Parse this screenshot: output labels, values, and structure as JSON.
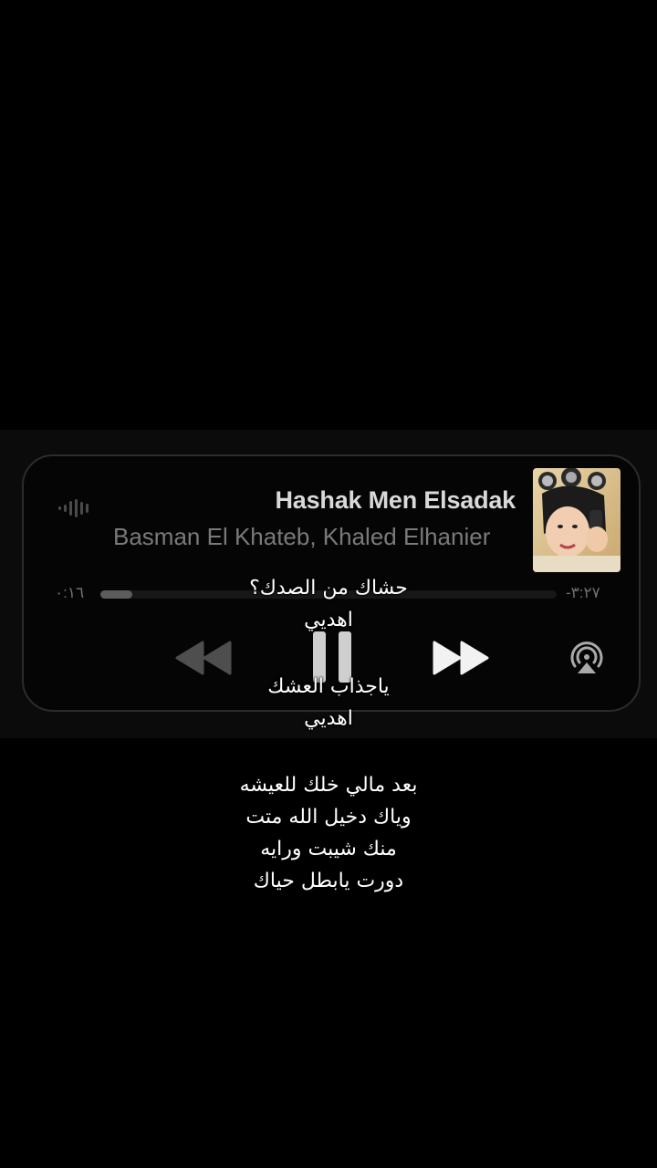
{
  "now_playing": {
    "title": "Hashak Men Elsadak",
    "artist": "Basman El Khateb, Khaled Elhanier",
    "elapsed": "٠:١٦",
    "remaining": "-٣:٢٧",
    "progress": 0.07
  },
  "controls": {
    "rewind_icon": "rewind-icon",
    "pause_icon": "pause-icon",
    "forward_icon": "fast-forward-icon",
    "airplay_icon": "airplay-icon",
    "waveform_icon": "waveform-icon"
  },
  "lyrics": {
    "block1": [
      "حشاك من الصدك؟",
      "اهديي"
    ],
    "block2": [
      "ياجذاب العشك",
      "اهديي"
    ],
    "block3": [
      "بعد مالي خلك للعيشه",
      "وياك دخيل الله متت",
      "منك شيبت ورايه",
      "دورت يابطل حياك"
    ]
  },
  "colors": {
    "background": "#000000",
    "card": "#050505",
    "title": "#d9d9d9",
    "artist": "#7a7a7a"
  }
}
